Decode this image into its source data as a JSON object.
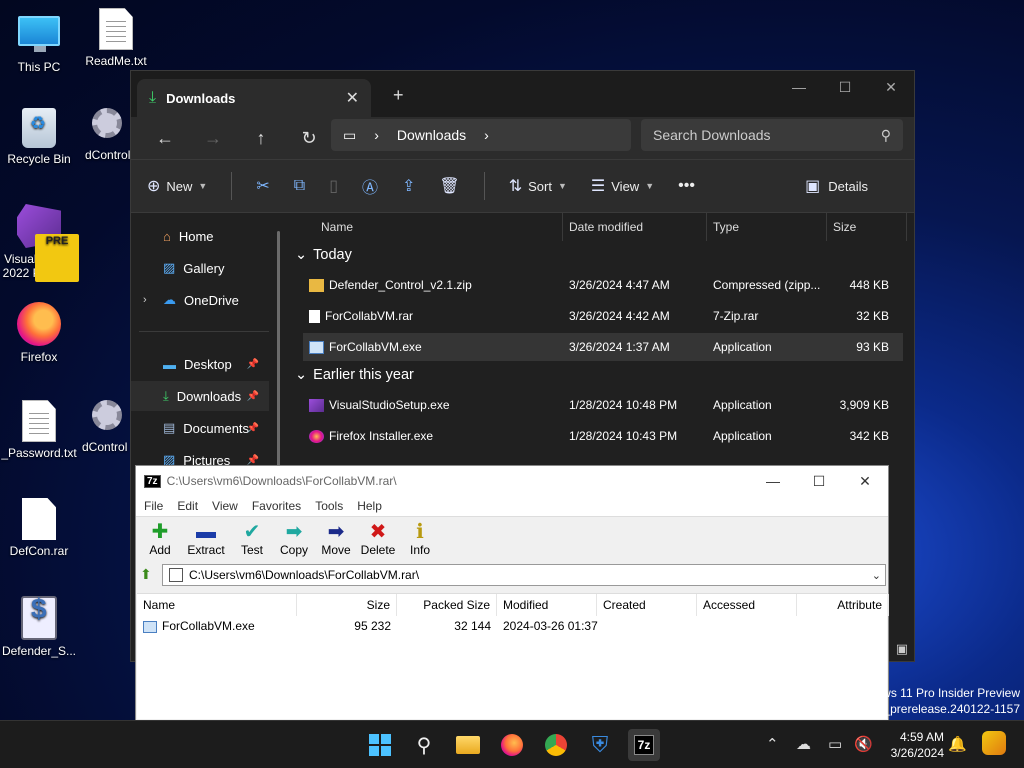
{
  "desktop": {
    "icons": [
      {
        "label": "This PC"
      },
      {
        "label": "ReadMe.txt"
      },
      {
        "label": "Recycle Bin"
      },
      {
        "label": "dControl"
      },
      {
        "label": "Visual Studio 2022 Preview"
      },
      {
        "label": "Firefox"
      },
      {
        "label": "_Password.txt"
      },
      {
        "label": "dControl"
      },
      {
        "label": "DefCon.rar"
      },
      {
        "label": "Defender_S..."
      }
    ],
    "vs_badge": "PRE"
  },
  "explorer": {
    "tab_title": "Downloads",
    "address": {
      "location": "Downloads"
    },
    "search_placeholder": "Search Downloads",
    "commands": {
      "new": "New",
      "sort": "Sort",
      "view": "View",
      "more": "•••",
      "details": "Details"
    },
    "sidebar": [
      {
        "label": "Home"
      },
      {
        "label": "Gallery"
      },
      {
        "label": "OneDrive"
      },
      {
        "label": "Desktop"
      },
      {
        "label": "Downloads"
      },
      {
        "label": "Documents"
      },
      {
        "label": "Pictures"
      }
    ],
    "columns": [
      "Name",
      "Date modified",
      "Type",
      "Size"
    ],
    "groups": [
      {
        "title": "Today",
        "files": [
          {
            "name": "Defender_Control_v2.1.zip",
            "date": "3/26/2024 4:47 AM",
            "type": "Compressed (zipp...",
            "size": "448 KB"
          },
          {
            "name": "ForCollabVM.rar",
            "date": "3/26/2024 4:42 AM",
            "type": "7-Zip.rar",
            "size": "32 KB"
          },
          {
            "name": "ForCollabVM.exe",
            "date": "3/26/2024 1:37 AM",
            "type": "Application",
            "size": "93 KB"
          }
        ]
      },
      {
        "title": "Earlier this year",
        "files": [
          {
            "name": "VisualStudioSetup.exe",
            "date": "1/28/2024 10:48 PM",
            "type": "Application",
            "size": "3,909 KB"
          },
          {
            "name": "Firefox Installer.exe",
            "date": "1/28/2024 10:43 PM",
            "type": "Application",
            "size": "342 KB"
          }
        ]
      }
    ]
  },
  "sevenzip": {
    "title": "C:\\Users\\vm6\\Downloads\\ForCollabVM.rar\\",
    "logo": "7z",
    "menu": [
      "File",
      "Edit",
      "View",
      "Favorites",
      "Tools",
      "Help"
    ],
    "toolbar": [
      "Add",
      "Extract",
      "Test",
      "Copy",
      "Move",
      "Delete",
      "Info"
    ],
    "path": "C:\\Users\\vm6\\Downloads\\ForCollabVM.rar\\",
    "columns": [
      "Name",
      "Size",
      "Packed Size",
      "Modified",
      "Created",
      "Accessed",
      "Attribute"
    ],
    "rows": [
      {
        "name": "ForCollabVM.exe",
        "size": "95 232",
        "packed": "32 144",
        "modified": "2024-03-26 01:37"
      }
    ]
  },
  "watermark": {
    "line1": "ws 11 Pro Insider Preview",
    "line2": "s_prerelease.240122-1157"
  },
  "taskbar": {
    "time": "4:59 AM",
    "date": "3/26/2024",
    "active_app_label": "7z"
  }
}
